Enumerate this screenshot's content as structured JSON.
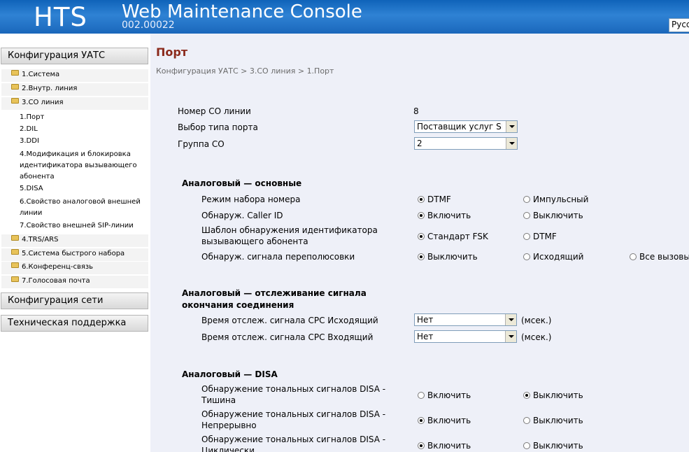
{
  "header": {
    "logo": "HTS",
    "title": "Web Maintenance Console",
    "version": "002.00022",
    "language": "Русс"
  },
  "sidebar": {
    "sections": [
      "Конфигурация УАТС",
      "Конфигурация сети",
      "Техническая поддержка"
    ],
    "items": [
      "1.Система",
      "2.Внутр. линия",
      "3.CO линия",
      "4.TRS/ARS",
      "5.Система быстрого набора",
      "6.Конференц-связь",
      "7.Голосовая почта"
    ],
    "co_sub": [
      "1.Порт",
      "2.DIL",
      "3.DDI",
      "4.Модификация и блокировка",
      "идентификатора вызывающего",
      "абонента",
      "5.DISA",
      "6.Свойство аналоговой внешней",
      "линии",
      "7.Свойство внешней SIP-линии"
    ]
  },
  "main": {
    "title": "Порт",
    "breadcrumb": "Конфигурация УАТС > 3.CO линия > 1.Порт",
    "co_number_label": "Номер CO линии",
    "co_number_value": "8",
    "port_type_label": "Выбор типа порта",
    "port_type_value": "Поставщик услуг SIP -",
    "co_group_label": "Группа CO",
    "co_group_value": "2",
    "sec1": {
      "title": "Аналоговый — основные",
      "rows": [
        {
          "label": "Режим набора номера",
          "opts": [
            "DTMF",
            "Импульсный"
          ]
        },
        {
          "label": "Обнаруж. Caller ID",
          "opts": [
            "Включить",
            "Выключить"
          ]
        },
        {
          "label1": "Шаблон обнаружения идентификатора",
          "label2": "вызывающего абонента",
          "opts": [
            "Стандарт FSK",
            "DTMF"
          ]
        },
        {
          "label": "Обнаруж. сигнала переполюсовки",
          "opts": [
            "Выключить",
            "Исходящий",
            "Все вызовы"
          ]
        }
      ]
    },
    "sec2": {
      "title1": "Аналоговый — отслеживание сигнала",
      "title2": "окончания соединения",
      "rows": [
        {
          "label": "Время отслеж. сигнала CPC Исходящий",
          "value": "Нет",
          "unit": "(мсек.)"
        },
        {
          "label": "Время отслеж. сигнала CPC Входящий",
          "value": "Нет",
          "unit": "(мсек.)"
        }
      ]
    },
    "sec3": {
      "title": "Аналоговый — DISA",
      "rows": [
        {
          "label1": "Обнаружение тональных сигналов DISA -",
          "label2": "Тишина",
          "opts": [
            "Включить",
            "Выключить"
          ]
        },
        {
          "label1": "Обнаружение тональных сигналов DISA -",
          "label2": "Непрерывно",
          "opts": [
            "Включить",
            "Выключить"
          ]
        },
        {
          "label1": "Обнаружение тональных сигналов DISA -",
          "label2": "Циклически",
          "opts": [
            "Включить",
            "Выключить"
          ]
        }
      ]
    }
  }
}
